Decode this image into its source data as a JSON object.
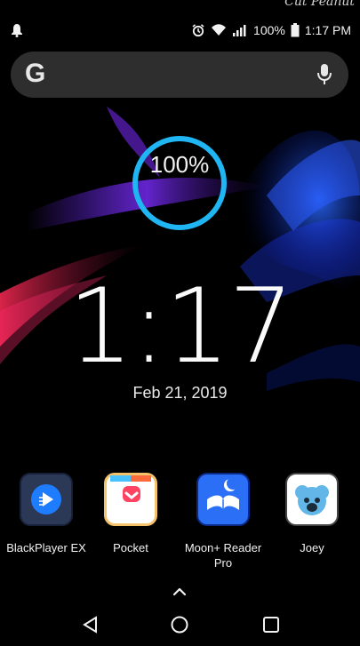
{
  "watermark": "Cut Peanut",
  "status": {
    "battery": "100%",
    "time": "1:17 PM"
  },
  "search": {
    "logo": "G",
    "left_icon": "google-logo",
    "right_icon": "mic-icon"
  },
  "widget": {
    "battery_percent": 100,
    "battery_label": "100%",
    "clock": "1:17",
    "date": "Feb 21, 2019"
  },
  "apps": [
    {
      "label": "BlackPlayer EX",
      "icon": "blackplayer-icon"
    },
    {
      "label": "Pocket",
      "icon": "pocket-icon"
    },
    {
      "label": "Moon+ Reader Pro",
      "icon": "moon-reader-icon"
    },
    {
      "label": "Joey",
      "icon": "joey-icon"
    }
  ],
  "colors": {
    "ring": "#1fb6f3",
    "search_bg": "#2e2e2e"
  }
}
